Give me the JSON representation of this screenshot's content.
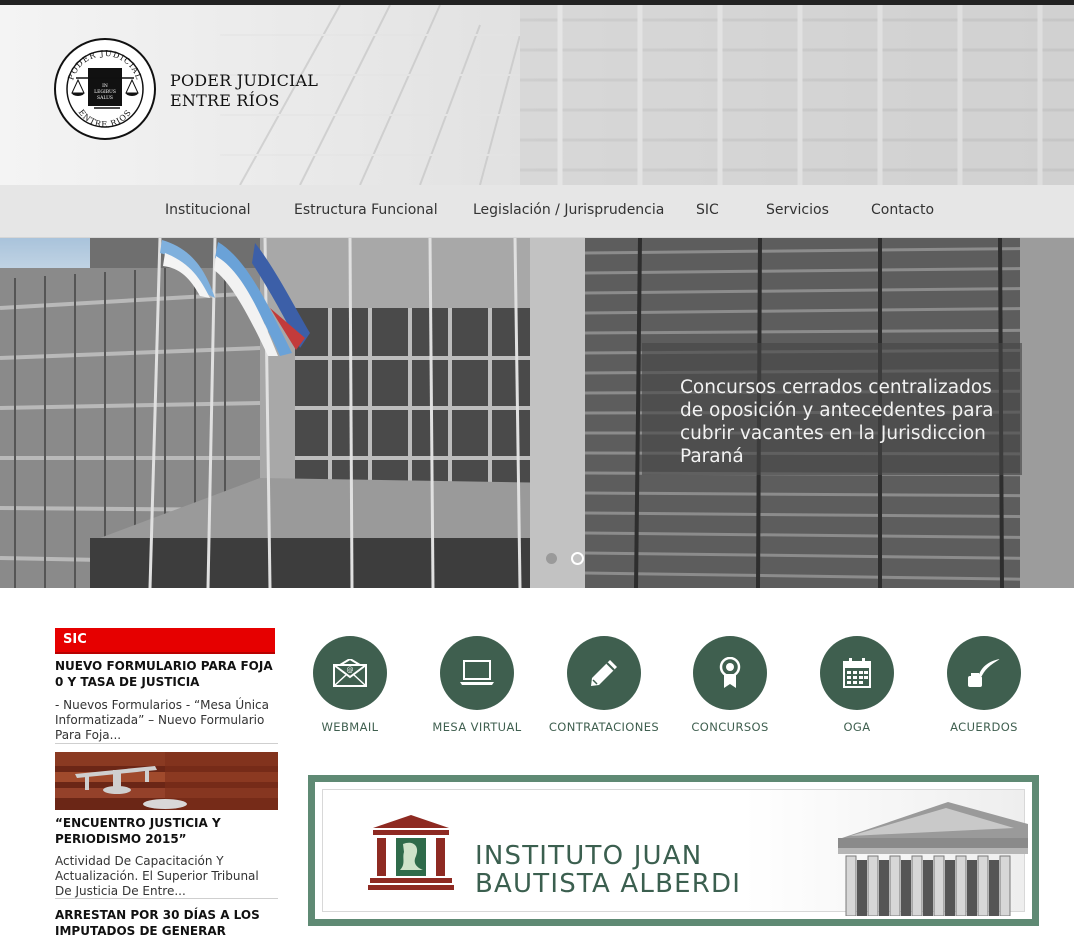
{
  "header": {
    "logo_line1": "PODER JUDICIAL",
    "logo_line2": "ENTRE RÍOS",
    "seal_top": "PODER JUDICIAL",
    "seal_bottom": "ENTRE RIOS",
    "seal_motto": "IN LEGIBUS SALUS"
  },
  "nav": {
    "items": [
      {
        "label": "Institucional"
      },
      {
        "label": "Estructura Funcional"
      },
      {
        "label": "Legislación / Jurisprudencia"
      },
      {
        "label": "SIC"
      },
      {
        "label": "Servicios"
      },
      {
        "label": "Contacto"
      }
    ]
  },
  "hero": {
    "caption": "Concursos cerrados centralizados de oposición y antecedentes para cubrir vacantes en la Jurisdiccion Paraná",
    "slides_count": 2,
    "active_slide": 2
  },
  "sidebar": {
    "tab": "SIC",
    "news": [
      {
        "title": "NUEVO FORMULARIO PARA FOJA 0 Y TASA DE JUSTICIA",
        "excerpt": "- Nuevos Formularios - “Mesa Única Informatizada” – Nuevo Formulario Para Foja..."
      },
      {
        "title": "“ENCUENTRO JUSTICIA Y PERIODISMO 2015”",
        "excerpt": "Actividad De Capacitación Y Actualización. El Superior Tribunal De Justicia De Entre..."
      },
      {
        "title": "ARRESTAN POR 30 DÍAS A LOS IMPUTADOS DE GENERAR",
        "excerpt": ""
      }
    ]
  },
  "quick_access": [
    {
      "label": "WEBMAIL",
      "icon": "envelope-icon"
    },
    {
      "label": "MESA VIRTUAL",
      "icon": "laptop-icon"
    },
    {
      "label": "CONTRATACIONES",
      "icon": "pencil-icon"
    },
    {
      "label": "CONCURSOS",
      "icon": "ribbon-award-icon"
    },
    {
      "label": "OGA",
      "icon": "calendar-icon"
    },
    {
      "label": "ACUERDOS",
      "icon": "quill-ink-icon"
    }
  ],
  "banner": {
    "line1": "INSTITUTO JUAN",
    "line2": "BAUTISTA ALBERDI"
  },
  "colors": {
    "accent_green": "#3f5f4f",
    "banner_border": "#5f8a74",
    "sic_red": "#e60000"
  }
}
